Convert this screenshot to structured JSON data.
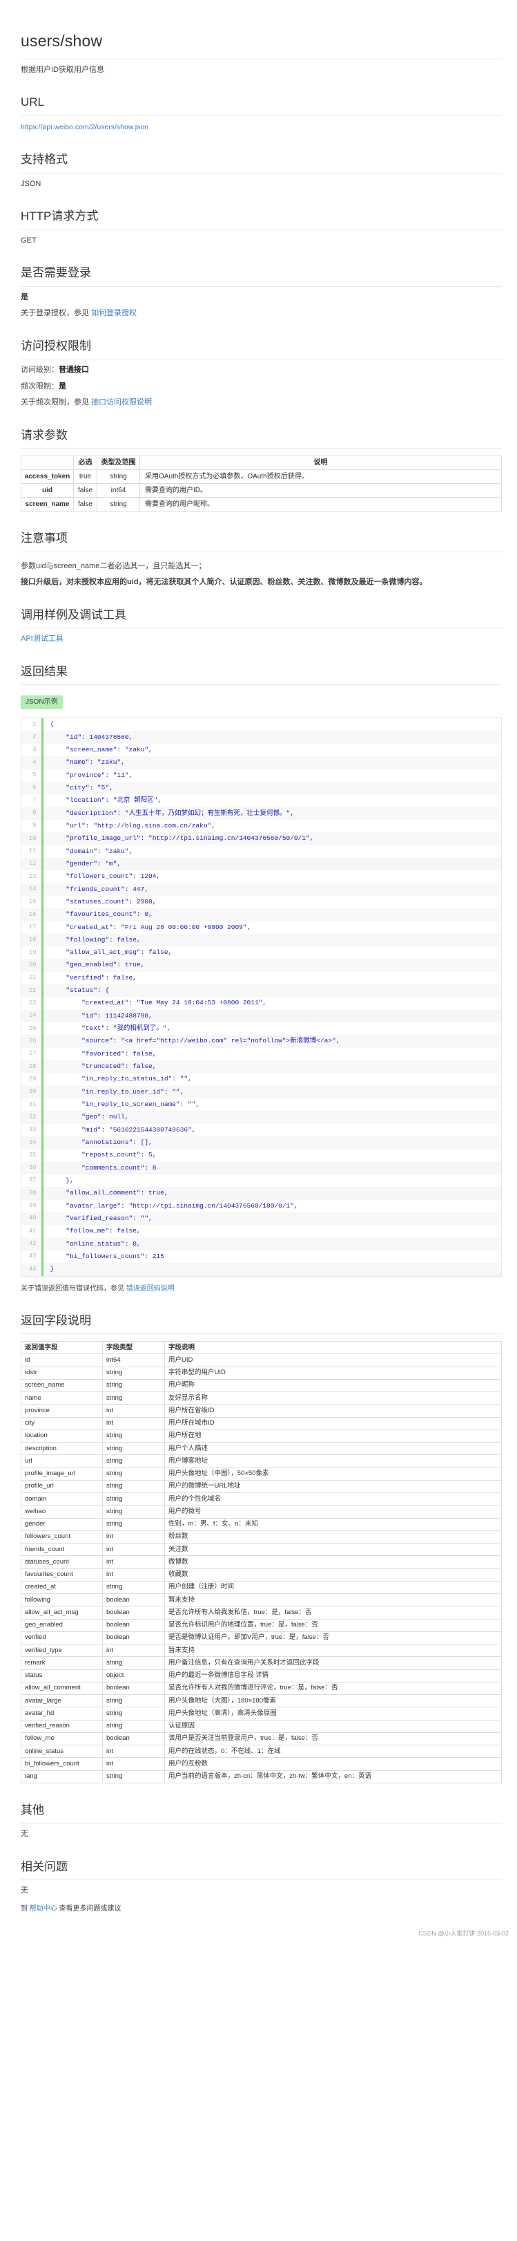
{
  "doc": {
    "title": "users/show",
    "subtitle": "根据用户ID获取用户信息"
  },
  "sections": {
    "url": {
      "heading": "URL",
      "value": "https://api.weibo.com/2/users/show.json"
    },
    "format": {
      "heading": "支持格式",
      "value": "JSON"
    },
    "http_method": {
      "heading": "HTTP请求方式",
      "value": "GET"
    },
    "login_required": {
      "heading": "是否需要登录",
      "value": "是",
      "note_prefix": "关于登录授权，参见 ",
      "note_link": "如何登录授权"
    },
    "access_limit": {
      "heading": "访问授权限制",
      "level_label": "访问级别：",
      "level_value": "普通接口",
      "rate_label": "频次限制：",
      "rate_value": "是",
      "note_prefix": "关于频次限制，参见 ",
      "note_link": "接口访问权限说明"
    },
    "request_params": {
      "heading": "请求参数",
      "columns": [
        "",
        "必选",
        "类型及范围",
        "说明"
      ],
      "rows": [
        {
          "name": "access_token",
          "required": "true",
          "type": "string",
          "desc": "采用OAuth授权方式为必填参数，OAuth授权后获得。"
        },
        {
          "name": "uid",
          "required": "false",
          "type": "int64",
          "desc": "需要查询的用户ID。"
        },
        {
          "name": "screen_name",
          "required": "false",
          "type": "string",
          "desc": "需要查询的用户昵称。"
        }
      ]
    },
    "notes": {
      "heading": "注意事项",
      "line1": "参数uid与screen_name二者必选其一，且只能选其一；",
      "line2": "接口升级后，对未授权本应用的uid，将无法获取其个人简介、认证原因、粉丝数、关注数、微博数及最近一条微博内容。"
    },
    "debug_tool": {
      "heading": "调用样例及调试工具",
      "link": "API测试工具"
    },
    "result": {
      "heading": "返回结果",
      "badge": "JSON示例"
    },
    "result_footer": {
      "prefix": "关于错误返回值与错误代码，参见 ",
      "link": "错误返回码说明"
    },
    "field_desc": {
      "heading": "返回字段说明",
      "columns": [
        "返回值字段",
        "字段类型",
        "字段说明"
      ],
      "rows": [
        {
          "field": "id",
          "type": "int64",
          "desc": "用户UID"
        },
        {
          "field": "idstr",
          "type": "string",
          "desc": "字符串型的用户UID"
        },
        {
          "field": "screen_name",
          "type": "string",
          "desc": "用户昵称"
        },
        {
          "field": "name",
          "type": "string",
          "desc": "友好显示名称"
        },
        {
          "field": "province",
          "type": "int",
          "desc": "用户所在省级ID"
        },
        {
          "field": "city",
          "type": "int",
          "desc": "用户所在城市ID"
        },
        {
          "field": "location",
          "type": "string",
          "desc": "用户所在地"
        },
        {
          "field": "description",
          "type": "string",
          "desc": "用户个人描述"
        },
        {
          "field": "url",
          "type": "string",
          "desc": "用户博客地址"
        },
        {
          "field": "profile_image_url",
          "type": "string",
          "desc": "用户头像地址（中图），50×50像素"
        },
        {
          "field": "profile_url",
          "type": "string",
          "desc": "用户的微博统一URL地址"
        },
        {
          "field": "domain",
          "type": "string",
          "desc": "用户的个性化域名"
        },
        {
          "field": "weihao",
          "type": "string",
          "desc": "用户的微号"
        },
        {
          "field": "gender",
          "type": "string",
          "desc": "性别，m：男、f：女、n：未知"
        },
        {
          "field": "followers_count",
          "type": "int",
          "desc": "粉丝数"
        },
        {
          "field": "friends_count",
          "type": "int",
          "desc": "关注数"
        },
        {
          "field": "statuses_count",
          "type": "int",
          "desc": "微博数"
        },
        {
          "field": "favourites_count",
          "type": "int",
          "desc": "收藏数"
        },
        {
          "field": "created_at",
          "type": "string",
          "desc": "用户创建（注册）时间"
        },
        {
          "field": "following",
          "type": "boolean",
          "desc": "暂未支持"
        },
        {
          "field": "allow_all_act_msg",
          "type": "boolean",
          "desc": "是否允许所有人给我发私信，true：是，false：否"
        },
        {
          "field": "geo_enabled",
          "type": "boolean",
          "desc": "是否允许标识用户的地理位置，true：是，false：否"
        },
        {
          "field": "verified",
          "type": "boolean",
          "desc": "是否是微博认证用户，即加V用户，true：是，false：否"
        },
        {
          "field": "verified_type",
          "type": "int",
          "desc": "暂未支持"
        },
        {
          "field": "remark",
          "type": "string",
          "desc": "用户备注信息，只有在查询用户关系时才返回此字段"
        },
        {
          "field": "status",
          "type": "object",
          "desc": "用户的最近一条微博信息字段 详情"
        },
        {
          "field": "allow_all_comment",
          "type": "boolean",
          "desc": "是否允许所有人对我的微博进行评论，true：是，false：否"
        },
        {
          "field": "avatar_large",
          "type": "string",
          "desc": "用户头像地址（大图），180×180像素"
        },
        {
          "field": "avatar_hd",
          "type": "string",
          "desc": "用户头像地址（高清），高清头像原图"
        },
        {
          "field": "verified_reason",
          "type": "string",
          "desc": "认证原因"
        },
        {
          "field": "follow_me",
          "type": "boolean",
          "desc": "该用户是否关注当前登录用户，true：是，false：否"
        },
        {
          "field": "online_status",
          "type": "int",
          "desc": "用户的在线状态，0：不在线、1：在线"
        },
        {
          "field": "bi_followers_count",
          "type": "int",
          "desc": "用户的互粉数"
        },
        {
          "field": "lang",
          "type": "string",
          "desc": "用户当前的语言版本，zh-cn：简体中文，zh-tw：繁体中文，en：英语"
        }
      ]
    },
    "other": {
      "heading": "其他",
      "value": "无"
    },
    "related": {
      "heading": "相关问题",
      "value": "无",
      "footer_prefix": "到 帮助中心 查看更多问题或建议",
      "footer_link": "帮助中心"
    }
  },
  "code_block": {
    "lines": [
      "{",
      "    \"id\": 1404376560,",
      "    \"screen_name\": \"zaku\",",
      "    \"name\": \"zaku\",",
      "    \"province\": \"11\",",
      "    \"city\": \"5\",",
      "    \"location\": \"北京 朝阳区\",",
      "    \"description\": \"人生五十年，乃如梦如幻；有生斯有死，壮士复何憾。\",",
      "    \"url\": \"http://blog.sina.com.cn/zaku\",",
      "    \"profile_image_url\": \"http://tp1.sinaimg.cn/1404376560/50/0/1\",",
      "    \"domain\": \"zaku\",",
      "    \"gender\": \"m\",",
      "    \"followers_count\": 1204,",
      "    \"friends_count\": 447,",
      "    \"statuses_count\": 2908,",
      "    \"favourites_count\": 0,",
      "    \"created_at\": \"Fri Aug 28 00:00:00 +0800 2009\",",
      "    \"following\": false,",
      "    \"allow_all_act_msg\": false,",
      "    \"geo_enabled\": true,",
      "    \"verified\": false,",
      "    \"status\": {",
      "        \"created_at\": \"Tue May 24 18:04:53 +0800 2011\",",
      "        \"id\": 11142488790,",
      "        \"text\": \"我的相机到了。\",",
      "        \"source\": \"<a href=\"http://weibo.com\" rel=\"nofollow\">新浪微博</a>\",",
      "        \"favorited\": false,",
      "        \"truncated\": false,",
      "        \"in_reply_to_status_id\": \"\",",
      "        \"in_reply_to_user_id\": \"\",",
      "        \"in_reply_to_screen_name\": \"\",",
      "        \"geo\": null,",
      "        \"mid\": \"5610221544300749636\",",
      "        \"annotations\": [],",
      "        \"reposts_count\": 5,",
      "        \"comments_count\": 8",
      "    },",
      "    \"allow_all_comment\": true,",
      "    \"avatar_large\": \"http://tp1.sinaimg.cn/1404376560/180/0/1\",",
      "    \"verified_reason\": \"\",",
      "    \"follow_me\": false,",
      "    \"online_status\": 0,",
      "    \"bi_followers_count\": 215",
      "}"
    ]
  },
  "watermark": "CSDN @小人家打饼 2015-03-02"
}
